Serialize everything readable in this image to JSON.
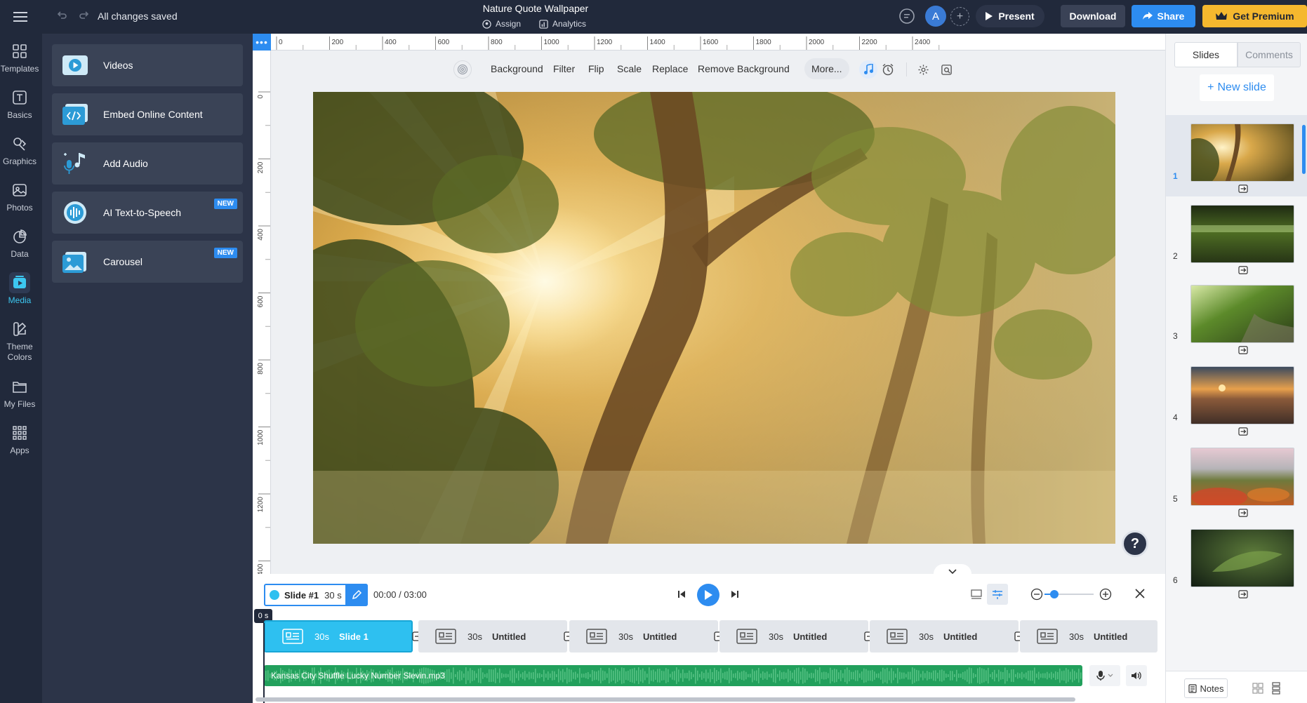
{
  "topbar": {
    "saved_status": "All changes saved",
    "title": "Nature Quote Wallpaper",
    "assign_label": "Assign",
    "analytics_label": "Analytics",
    "avatar_initial": "A",
    "present_label": "Present",
    "download_label": "Download",
    "share_label": "Share",
    "premium_label": "Get Premium"
  },
  "leftnav": {
    "items": [
      {
        "label": "Templates",
        "icon": "templates-icon"
      },
      {
        "label": "Basics",
        "icon": "text-icon"
      },
      {
        "label": "Graphics",
        "icon": "graphics-icon"
      },
      {
        "label": "Photos",
        "icon": "photos-icon"
      },
      {
        "label": "Data",
        "icon": "pie-chart-icon"
      },
      {
        "label": "Media",
        "icon": "media-icon",
        "active": true
      },
      {
        "label": "Theme Colors",
        "icon": "palette-icon"
      },
      {
        "label": "My Files",
        "icon": "folder-icon"
      },
      {
        "label": "Apps",
        "icon": "apps-grid-icon"
      }
    ]
  },
  "media_panel": {
    "cards": [
      {
        "label": "Videos",
        "icon": "play-video-icon"
      },
      {
        "label": "Embed Online Content",
        "icon": "embed-code-icon"
      },
      {
        "label": "Add Audio",
        "icon": "music-mic-icon"
      },
      {
        "label": "AI Text-to-Speech",
        "icon": "waveform-icon",
        "badge": "NEW"
      },
      {
        "label": "Carousel",
        "icon": "carousel-icon",
        "badge": "NEW"
      }
    ]
  },
  "ruler": {
    "corner": "•••",
    "h_labels": [
      "0",
      "200",
      "400",
      "600",
      "800",
      "1000",
      "1200",
      "1400",
      "1600",
      "1800",
      "2000",
      "2200",
      "2400"
    ],
    "v_labels": [
      "0",
      "200",
      "400",
      "600",
      "800",
      "1000",
      "1200",
      "400"
    ]
  },
  "toolbar": {
    "items": [
      "Background",
      "Filter",
      "Flip",
      "Scale",
      "Replace",
      "Remove Background"
    ],
    "more_label": "More..."
  },
  "help_label": "?",
  "timeline": {
    "slide_name": "Slide #1",
    "slide_duration": "30 s",
    "time": "00:00 / 03:00",
    "zoom_level": 0.2,
    "start_marker": "0 s",
    "clips": [
      {
        "duration": "30s",
        "title": "Slide 1",
        "active": true
      },
      {
        "duration": "30s",
        "title": "Untitled"
      },
      {
        "duration": "30s",
        "title": "Untitled"
      },
      {
        "duration": "30s",
        "title": "Untitled"
      },
      {
        "duration": "30s",
        "title": "Untitled"
      },
      {
        "duration": "30s",
        "title": "Untitled"
      }
    ],
    "audio_file": "Kansas City Shuffle Lucky Number Slevin.mp3"
  },
  "right_panel": {
    "tab_slides": "Slides",
    "tab_comments": "Comments",
    "new_slide_label": "New slide",
    "slides": [
      {
        "number": "1",
        "theme": "sunlit-forest",
        "active": true
      },
      {
        "number": "2",
        "theme": "grass-field"
      },
      {
        "number": "3",
        "theme": "mossy-stream"
      },
      {
        "number": "4",
        "theme": "sunset-clouds"
      },
      {
        "number": "5",
        "theme": "autumn-hills"
      },
      {
        "number": "6",
        "theme": "green-leaf"
      }
    ],
    "notes_label": "Notes"
  },
  "colors": {
    "accent": "#2d8cf0",
    "active_nav": "#3cc7f0",
    "audio_track": "#22a05c",
    "premium": "#f5b82e",
    "dark_chrome": "#21293b"
  }
}
